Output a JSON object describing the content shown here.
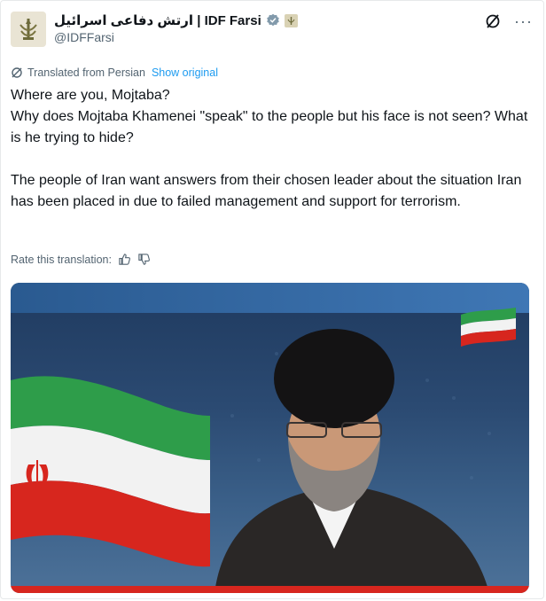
{
  "account": {
    "display_name": "ارتش دفاعی اسرائیل | IDF Farsi",
    "handle": "@IDFFarsi"
  },
  "translation": {
    "notice": "Translated from Persian",
    "show_original": "Show original",
    "rate_label": "Rate this translation:"
  },
  "tweet": {
    "line1": "Where are you, Mojtaba?",
    "line2": "Why does Mojtaba Khamenei \"speak\" to the people but his face is not seen? What is he trying to hide?",
    "line3": "The people of Iran want answers from their chosen leader about the situation Iran has been placed in due to failed management and support for terrorism."
  },
  "colors": {
    "link": "#1d9bf0",
    "muted": "#536471",
    "verified": "#829aab"
  },
  "icons": [
    "verified-badge-icon",
    "grok-icon",
    "more-icon",
    "translate-icon",
    "thumbs-up-icon",
    "thumbs-down-icon"
  ]
}
